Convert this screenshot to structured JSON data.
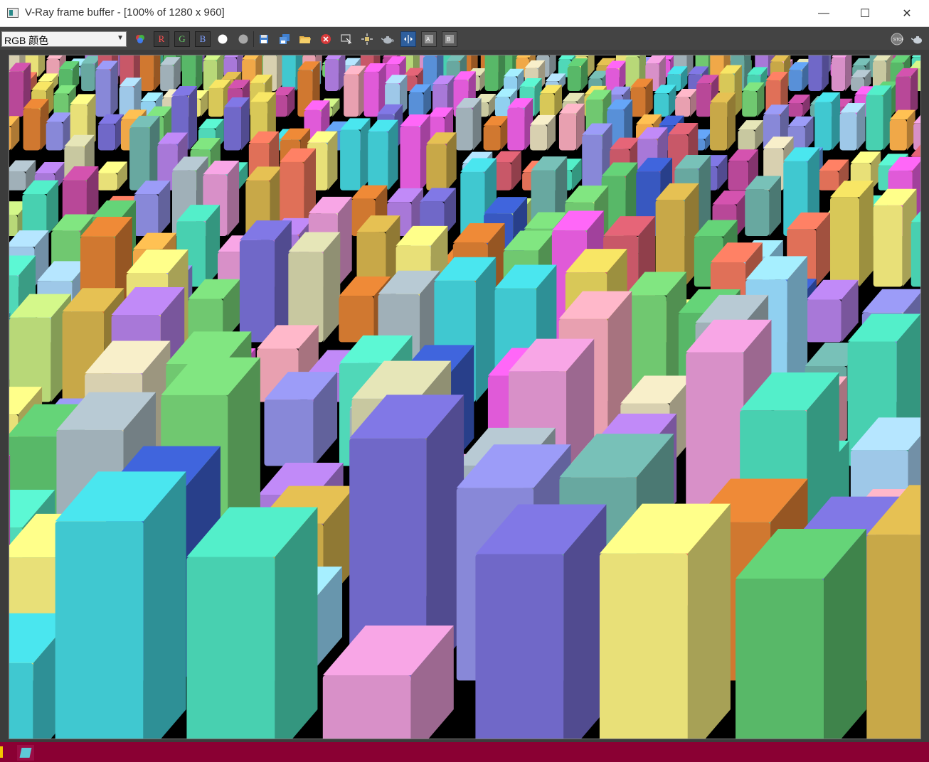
{
  "window": {
    "title": "V-Ray frame buffer - [100% of 1280 x 960]",
    "controls": {
      "minimize": "—",
      "maximize": "☐",
      "close": "✕"
    }
  },
  "toolbar": {
    "channel": "RGB 颜色",
    "channel_buttons": {
      "r": "R",
      "g": "G",
      "b": "B"
    },
    "icons": [
      "color-channels-icon",
      "white-circle-icon",
      "gray-circle-icon",
      "save-icon",
      "save-all-icon",
      "open-folder-icon",
      "clear-icon",
      "track-mouse-icon",
      "region-render-icon",
      "teapot-icon",
      "compare-icon",
      "history-icon",
      "settings-icon",
      "stop-icon",
      "render-teapot-icon"
    ]
  },
  "colors": {
    "toolbar_bg": "#444444",
    "frame_bg": "#000000",
    "taskbar_bg": "#8a0033"
  }
}
